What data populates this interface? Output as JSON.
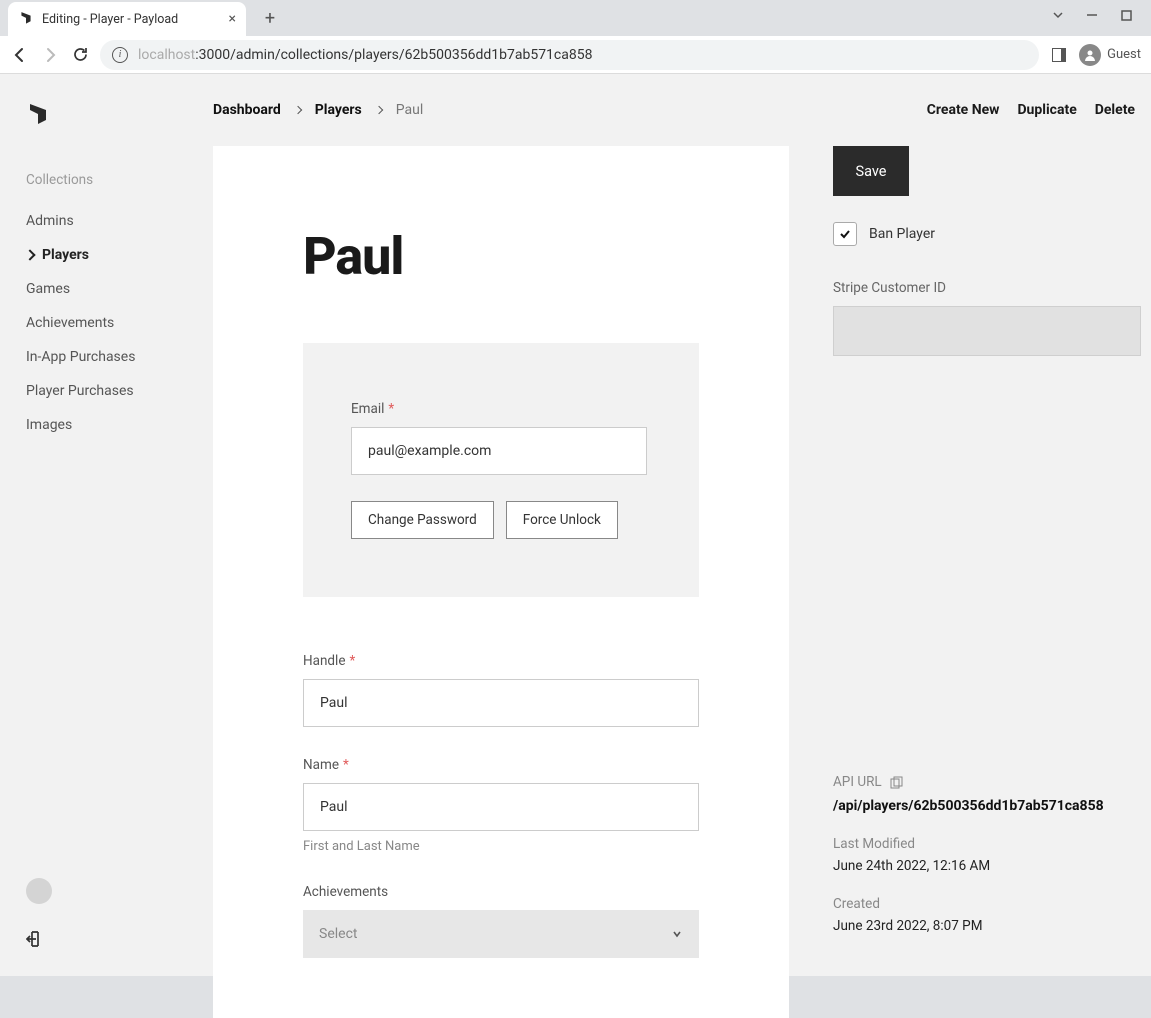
{
  "browser": {
    "tab_title": "Editing - Player - Payload",
    "url_host": "localhost",
    "url_rest": ":3000/admin/collections/players/62b500356dd1b7ab571ca858",
    "profile": "Guest"
  },
  "sidebar": {
    "section": "Collections",
    "items": [
      {
        "label": "Admins"
      },
      {
        "label": "Players"
      },
      {
        "label": "Games"
      },
      {
        "label": "Achievements"
      },
      {
        "label": "In-App Purchases"
      },
      {
        "label": "Player Purchases"
      },
      {
        "label": "Images"
      }
    ],
    "active_index": 1
  },
  "breadcrumb": {
    "dashboard": "Dashboard",
    "collection": "Players",
    "current": "Paul"
  },
  "actions": {
    "create": "Create New",
    "duplicate": "Duplicate",
    "delete": "Delete",
    "save": "Save"
  },
  "title": "Paul",
  "form": {
    "email_label": "Email",
    "email_value": "paul@example.com",
    "change_password": "Change Password",
    "force_unlock": "Force Unlock",
    "handle_label": "Handle",
    "handle_value": "Paul",
    "name_label": "Name",
    "name_value": "Paul",
    "name_hint": "First and Last Name",
    "achievements_label": "Achievements",
    "achievements_placeholder": "Select"
  },
  "side": {
    "ban_label": "Ban Player",
    "ban_checked": true,
    "stripe_label": "Stripe Customer ID",
    "api_url_label": "API URL",
    "api_url": "/api/players/62b500356dd1b7ab571ca858",
    "last_mod_label": "Last Modified",
    "last_mod_value": "June 24th 2022, 12:16 AM",
    "created_label": "Created",
    "created_value": "June 23rd 2022, 8:07 PM"
  }
}
